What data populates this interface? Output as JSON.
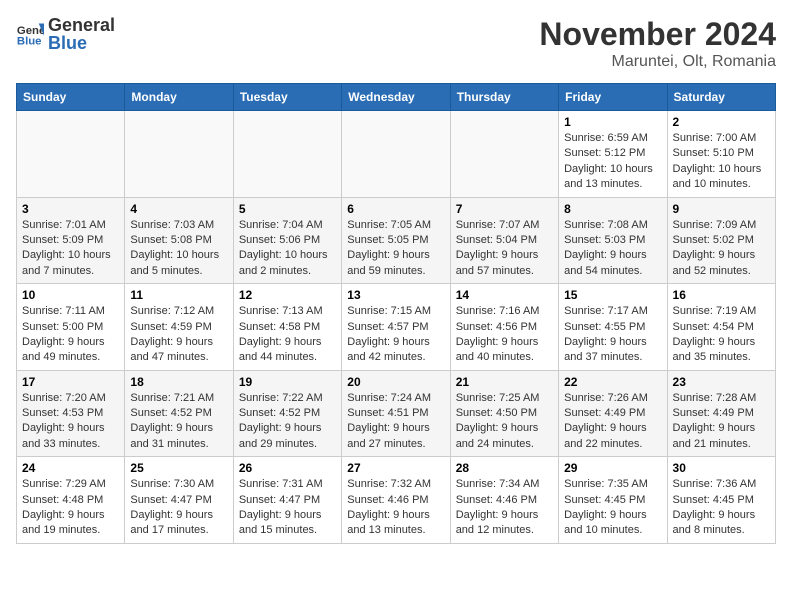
{
  "header": {
    "logo_general": "General",
    "logo_blue": "Blue",
    "month_title": "November 2024",
    "location": "Maruntei, Olt, Romania"
  },
  "weekdays": [
    "Sunday",
    "Monday",
    "Tuesday",
    "Wednesday",
    "Thursday",
    "Friday",
    "Saturday"
  ],
  "weeks": [
    [
      {
        "day": "",
        "info": ""
      },
      {
        "day": "",
        "info": ""
      },
      {
        "day": "",
        "info": ""
      },
      {
        "day": "",
        "info": ""
      },
      {
        "day": "",
        "info": ""
      },
      {
        "day": "1",
        "info": "Sunrise: 6:59 AM\nSunset: 5:12 PM\nDaylight: 10 hours and 13 minutes."
      },
      {
        "day": "2",
        "info": "Sunrise: 7:00 AM\nSunset: 5:10 PM\nDaylight: 10 hours and 10 minutes."
      }
    ],
    [
      {
        "day": "3",
        "info": "Sunrise: 7:01 AM\nSunset: 5:09 PM\nDaylight: 10 hours and 7 minutes."
      },
      {
        "day": "4",
        "info": "Sunrise: 7:03 AM\nSunset: 5:08 PM\nDaylight: 10 hours and 5 minutes."
      },
      {
        "day": "5",
        "info": "Sunrise: 7:04 AM\nSunset: 5:06 PM\nDaylight: 10 hours and 2 minutes."
      },
      {
        "day": "6",
        "info": "Sunrise: 7:05 AM\nSunset: 5:05 PM\nDaylight: 9 hours and 59 minutes."
      },
      {
        "day": "7",
        "info": "Sunrise: 7:07 AM\nSunset: 5:04 PM\nDaylight: 9 hours and 57 minutes."
      },
      {
        "day": "8",
        "info": "Sunrise: 7:08 AM\nSunset: 5:03 PM\nDaylight: 9 hours and 54 minutes."
      },
      {
        "day": "9",
        "info": "Sunrise: 7:09 AM\nSunset: 5:02 PM\nDaylight: 9 hours and 52 minutes."
      }
    ],
    [
      {
        "day": "10",
        "info": "Sunrise: 7:11 AM\nSunset: 5:00 PM\nDaylight: 9 hours and 49 minutes."
      },
      {
        "day": "11",
        "info": "Sunrise: 7:12 AM\nSunset: 4:59 PM\nDaylight: 9 hours and 47 minutes."
      },
      {
        "day": "12",
        "info": "Sunrise: 7:13 AM\nSunset: 4:58 PM\nDaylight: 9 hours and 44 minutes."
      },
      {
        "day": "13",
        "info": "Sunrise: 7:15 AM\nSunset: 4:57 PM\nDaylight: 9 hours and 42 minutes."
      },
      {
        "day": "14",
        "info": "Sunrise: 7:16 AM\nSunset: 4:56 PM\nDaylight: 9 hours and 40 minutes."
      },
      {
        "day": "15",
        "info": "Sunrise: 7:17 AM\nSunset: 4:55 PM\nDaylight: 9 hours and 37 minutes."
      },
      {
        "day": "16",
        "info": "Sunrise: 7:19 AM\nSunset: 4:54 PM\nDaylight: 9 hours and 35 minutes."
      }
    ],
    [
      {
        "day": "17",
        "info": "Sunrise: 7:20 AM\nSunset: 4:53 PM\nDaylight: 9 hours and 33 minutes."
      },
      {
        "day": "18",
        "info": "Sunrise: 7:21 AM\nSunset: 4:52 PM\nDaylight: 9 hours and 31 minutes."
      },
      {
        "day": "19",
        "info": "Sunrise: 7:22 AM\nSunset: 4:52 PM\nDaylight: 9 hours and 29 minutes."
      },
      {
        "day": "20",
        "info": "Sunrise: 7:24 AM\nSunset: 4:51 PM\nDaylight: 9 hours and 27 minutes."
      },
      {
        "day": "21",
        "info": "Sunrise: 7:25 AM\nSunset: 4:50 PM\nDaylight: 9 hours and 24 minutes."
      },
      {
        "day": "22",
        "info": "Sunrise: 7:26 AM\nSunset: 4:49 PM\nDaylight: 9 hours and 22 minutes."
      },
      {
        "day": "23",
        "info": "Sunrise: 7:28 AM\nSunset: 4:49 PM\nDaylight: 9 hours and 21 minutes."
      }
    ],
    [
      {
        "day": "24",
        "info": "Sunrise: 7:29 AM\nSunset: 4:48 PM\nDaylight: 9 hours and 19 minutes."
      },
      {
        "day": "25",
        "info": "Sunrise: 7:30 AM\nSunset: 4:47 PM\nDaylight: 9 hours and 17 minutes."
      },
      {
        "day": "26",
        "info": "Sunrise: 7:31 AM\nSunset: 4:47 PM\nDaylight: 9 hours and 15 minutes."
      },
      {
        "day": "27",
        "info": "Sunrise: 7:32 AM\nSunset: 4:46 PM\nDaylight: 9 hours and 13 minutes."
      },
      {
        "day": "28",
        "info": "Sunrise: 7:34 AM\nSunset: 4:46 PM\nDaylight: 9 hours and 12 minutes."
      },
      {
        "day": "29",
        "info": "Sunrise: 7:35 AM\nSunset: 4:45 PM\nDaylight: 9 hours and 10 minutes."
      },
      {
        "day": "30",
        "info": "Sunrise: 7:36 AM\nSunset: 4:45 PM\nDaylight: 9 hours and 8 minutes."
      }
    ]
  ]
}
